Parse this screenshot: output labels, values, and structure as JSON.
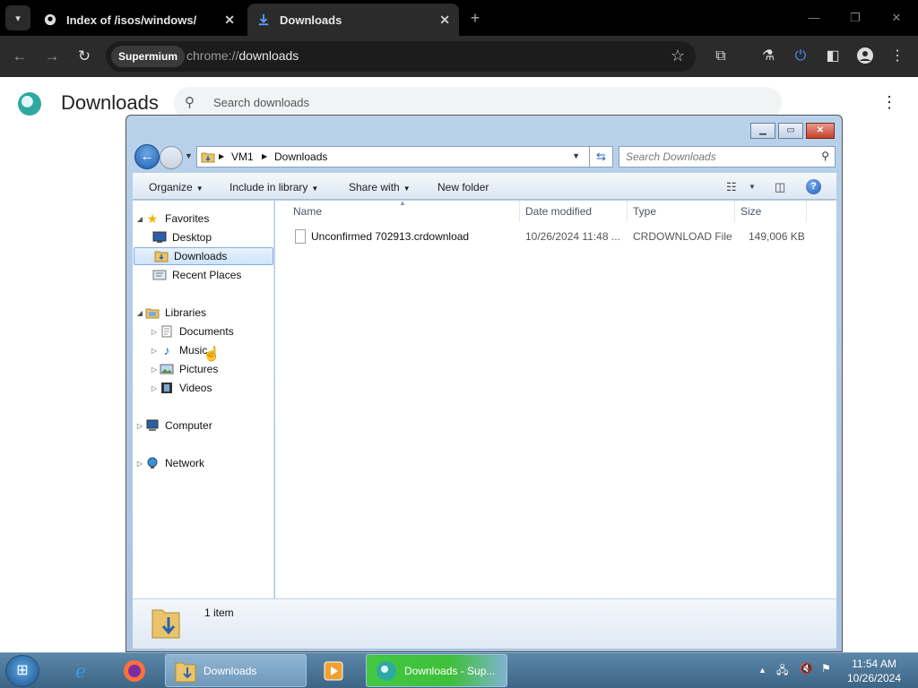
{
  "browser": {
    "tabs": [
      {
        "title": "Index of /isos/windows/",
        "icon": "github-icon"
      },
      {
        "title": "Downloads",
        "icon": "download-icon"
      }
    ],
    "chip": "Supermium",
    "url_scheme": "chrome://",
    "url_host": "downloads"
  },
  "page": {
    "title": "Downloads",
    "search_placeholder": "Search downloads"
  },
  "explorer": {
    "breadcrumb": [
      "VM1",
      "Downloads"
    ],
    "search_placeholder": "Search Downloads",
    "commands": [
      "Organize",
      "Include in library",
      "Share with",
      "New folder"
    ],
    "nav": {
      "favorites": "Favorites",
      "desktop": "Desktop",
      "downloads": "Downloads",
      "recent_places": "Recent Places",
      "libraries": "Libraries",
      "documents": "Documents",
      "music": "Music",
      "pictures": "Pictures",
      "videos": "Videos",
      "computer": "Computer",
      "network": "Network"
    },
    "columns": [
      "Name",
      "Date modified",
      "Type",
      "Size"
    ],
    "files": [
      {
        "name": "Unconfirmed 702913.crdownload",
        "date": "10/26/2024 11:48 ...",
        "type": "CRDOWNLOAD File",
        "size": "149,006 KB"
      }
    ],
    "item_count": "1 item"
  },
  "taskbar": {
    "tasks": [
      "Downloads",
      "Downloads - Sup..."
    ],
    "time": "11:54 AM",
    "date": "10/26/2024"
  },
  "colors": {
    "browser_dark": "#2b2b2b",
    "explorer_frame": "#b9d1ea",
    "taskbar": "#4a7393",
    "active_task_green": "#3fbf3a"
  }
}
